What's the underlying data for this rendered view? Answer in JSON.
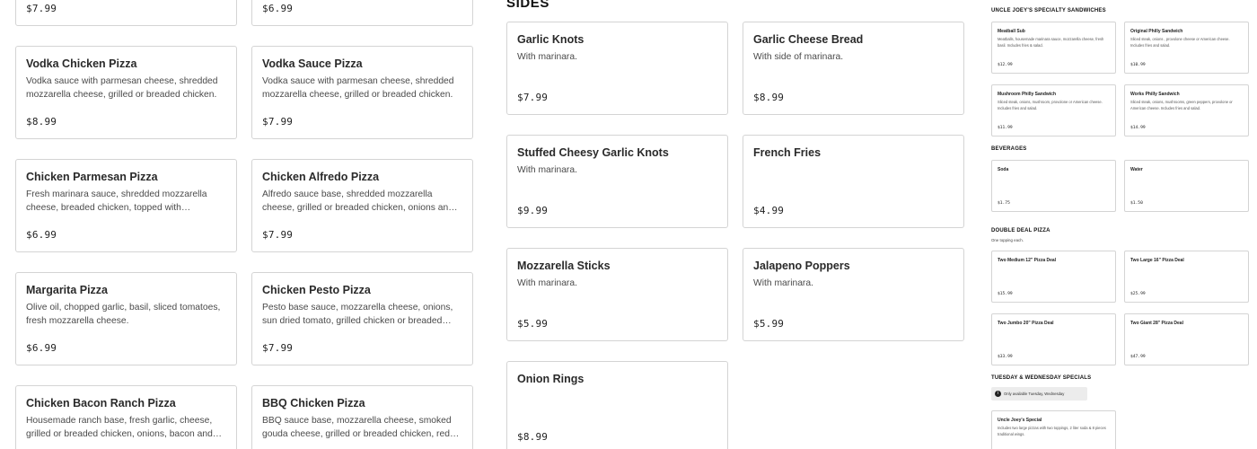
{
  "pizzas": {
    "top_prices": [
      "$7.99",
      "$6.99"
    ],
    "items": [
      {
        "name": "Vodka Chicken Pizza",
        "desc": "Vodka sauce with parmesan cheese, shredded mozzarella cheese, grilled or breaded chicken.",
        "price": "$8.99"
      },
      {
        "name": "Vodka Sauce Pizza",
        "desc": "Vodka sauce with parmesan cheese, shredded mozzarella cheese, grilled or breaded chicken.",
        "price": "$7.99"
      },
      {
        "name": "Chicken Parmesan Pizza",
        "desc": "Fresh marinara sauce, shredded mozzarella cheese, breaded chicken, topped with parmesan, basil.",
        "price": "$6.99"
      },
      {
        "name": "Chicken Alfredo Pizza",
        "desc": "Alfredo sauce base, shredded mozzarella cheese, grilled or breaded chicken, onions and broccoli.",
        "price": "$7.99"
      },
      {
        "name": "Margarita Pizza",
        "desc": "Olive oil, chopped garlic, basil, sliced tomatoes, fresh mozzarella cheese.",
        "price": "$6.99"
      },
      {
        "name": "Chicken Pesto Pizza",
        "desc": "Pesto base sauce, mozzarella cheese, onions, sun dried tomato, grilled chicken or breaded chicken.",
        "price": "$7.99"
      },
      {
        "name": "Chicken Bacon Ranch Pizza",
        "desc": "Housemade ranch base, fresh garlic, cheese, grilled or breaded chicken, onions, bacon and more.",
        "price": ""
      },
      {
        "name": "BBQ Chicken Pizza",
        "desc": "BBQ sauce base, mozzarella cheese, smoked gouda cheese, grilled or breaded chicken, red onions.",
        "price": ""
      }
    ]
  },
  "sides": {
    "heading": "SIDES",
    "items": [
      {
        "name": "Garlic Knots",
        "desc": "With marinara.",
        "price": "$7.99"
      },
      {
        "name": "Garlic Cheese Bread",
        "desc": "With side of marinara.",
        "price": "$8.99"
      },
      {
        "name": "Stuffed Cheesy Garlic Knots",
        "desc": "With marinara.",
        "price": "$9.99"
      },
      {
        "name": "French Fries",
        "desc": "",
        "price": "$4.99"
      },
      {
        "name": "Mozzarella Sticks",
        "desc": "With marinara.",
        "price": "$5.99"
      },
      {
        "name": "Jalapeno Poppers",
        "desc": "With marinara.",
        "price": "$5.99"
      },
      {
        "name": "Onion Rings",
        "desc": "",
        "price": "$8.99"
      }
    ]
  },
  "sandwiches": {
    "heading": "UNCLE JOEY'S SPECIALTY SANDWICHES",
    "items": [
      {
        "name": "Meatball Sub",
        "desc": "Meatballs, housemade marinara sauce, mozzarella cheese, fresh basil. Includes fries & salad.",
        "price": "$12.99"
      },
      {
        "name": "Original Philly Sandwich",
        "desc": "Sliced steak, onions , provolone cheese or American cheese. Includes fries and salad.",
        "price": "$10.99"
      },
      {
        "name": "Mushroom Philly Sandwich",
        "desc": "Sliced steak, onions, mushroom, provolone or American cheese. Includes fries and salad.",
        "price": "$11.99"
      },
      {
        "name": "Works Philly Sandwich",
        "desc": "Sliced steak, onions, mushrooms, green peppers, provolone or American cheese. Includes fries and salad.",
        "price": "$14.99"
      }
    ]
  },
  "beverages": {
    "heading": "BEVERAGES",
    "items": [
      {
        "name": "Soda",
        "price": "$1.75"
      },
      {
        "name": "Water",
        "price": "$1.50"
      }
    ]
  },
  "double_deal": {
    "heading": "DOUBLE DEAL PIZZA",
    "subheading": "One topping each.",
    "items": [
      {
        "name": "Two Medium 12\" Pizza Deal",
        "price": "$15.99"
      },
      {
        "name": "Two Large 16\" Pizza Deal",
        "price": "$25.99"
      },
      {
        "name": "Two Jumbo 20\" Pizza Deal",
        "price": "$33.99"
      },
      {
        "name": "Two Giant 28\" Pizza Deal",
        "price": "$47.99"
      }
    ]
  },
  "specials": {
    "heading": "TUESDAY & WEDNESDAY SPECIALS",
    "badge_icon": "i",
    "badge_text": "Only available Tuesday, Wednesday",
    "items": [
      {
        "name": "Uncle Joey's Special",
        "desc": "Includes two large pizzas with two toppings, 2 liter soda & 8 pieces traditional wings."
      }
    ]
  }
}
